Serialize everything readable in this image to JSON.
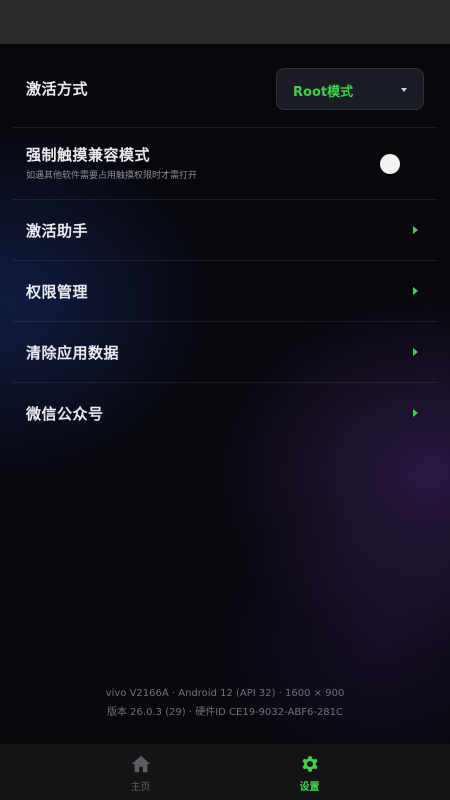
{
  "settings": {
    "activation_mode": {
      "label": "激活方式",
      "selected": "Root模式"
    },
    "force_touch_compat": {
      "label": "强制触摸兼容模式",
      "description": "如遇其他软件需要占用触摸权限时才需打开",
      "enabled": false
    },
    "items": [
      {
        "label": "激活助手"
      },
      {
        "label": "权限管理"
      },
      {
        "label": "清除应用数据"
      },
      {
        "label": "微信公众号"
      }
    ]
  },
  "footer": {
    "device_line": "vivo V2166A · Android 12 (API 32) · 1600 × 900",
    "version_line": "版本 26.0.3 (29) · 硬件ID CE19-9032-ABF6-281C"
  },
  "tabs": [
    {
      "label": "主页",
      "icon": "home-icon",
      "active": false
    },
    {
      "label": "设置",
      "icon": "gear-icon",
      "active": true
    }
  ],
  "colors": {
    "accent": "#3fd24a",
    "background": "#07070c",
    "tab_bar": "#141416",
    "status_bar": "#2a2a2c"
  }
}
